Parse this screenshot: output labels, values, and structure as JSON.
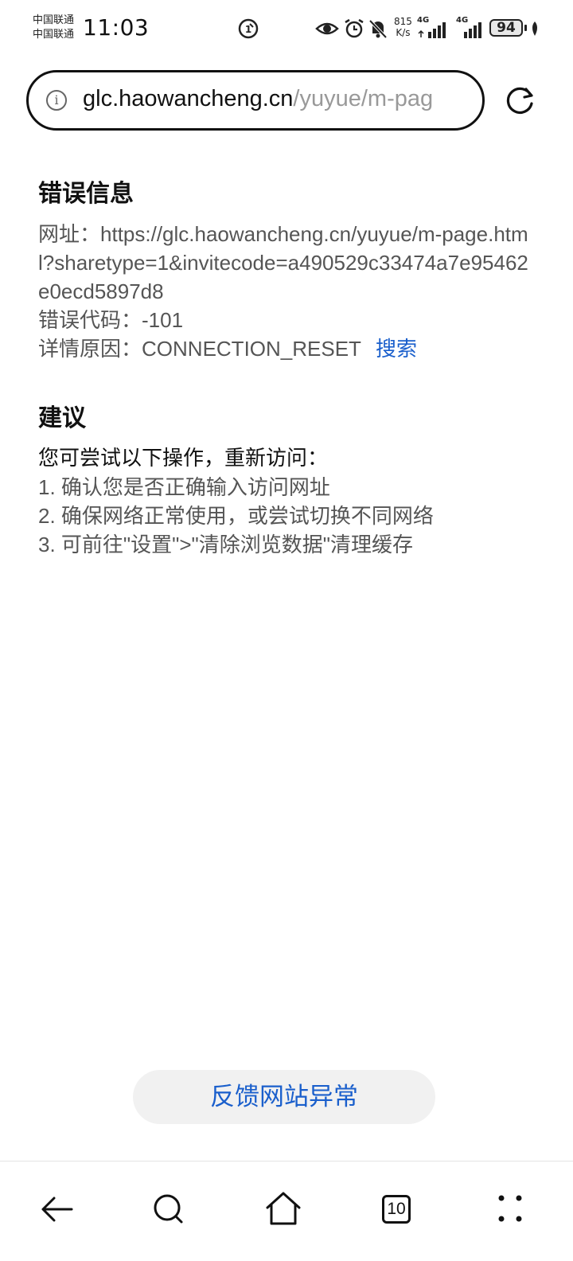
{
  "status_bar": {
    "carrier_1": "中国联通",
    "carrier_2": "中国联通",
    "time": "11:03",
    "net_speed_value": "815",
    "net_speed_unit": "K/s",
    "signal_1_label": "4G",
    "signal_2_label": "4G",
    "battery": "94",
    "icons": [
      "hd-call-icon",
      "eye-icon",
      "alarm-icon",
      "mute-bell-icon",
      "signal-icon",
      "signal-icon",
      "battery-icon",
      "leaf-icon"
    ]
  },
  "address_bar": {
    "host": "glc.haowancheng.cn",
    "path": "/yuyue/m-pag",
    "info_icon": "info-icon",
    "reload_icon": "reload-icon"
  },
  "error": {
    "title": "错误信息",
    "url_label": "网址：",
    "url_value": "https://glc.haowancheng.cn/yuyue/m-page.html?sharetype=1&invitecode=a490529c33474a7e95462e0ecd5897d8",
    "code_label": "错误代码：",
    "code_value": "-101",
    "reason_label": "详情原因：",
    "reason_value": "CONNECTION_RESET",
    "search_link": "搜索"
  },
  "suggestion": {
    "title": "建议",
    "lead": "您可尝试以下操作，重新访问：",
    "items": [
      "1. 确认您是否正确输入访问网址",
      "2. 确保网络正常使用，或尝试切换不同网络",
      "3. 可前往\"设置\">\"清除浏览数据\"清理缓存"
    ]
  },
  "feedback_button": "反馈网站异常",
  "bottom_nav": {
    "tab_count": "10",
    "icons": [
      "back-arrow-icon",
      "search-icon",
      "home-icon",
      "tabs-icon",
      "more-icon"
    ]
  },
  "colors": {
    "link": "#1a5fcc",
    "text": "#555555",
    "heading": "#111111"
  }
}
